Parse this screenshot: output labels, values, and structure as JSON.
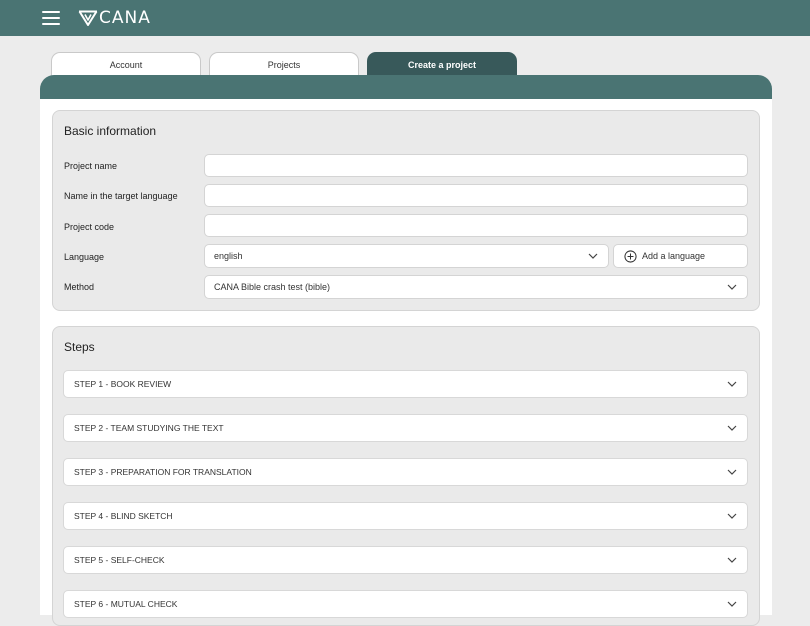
{
  "header": {
    "menu_icon": "hamburger-menu-icon",
    "logo_text": "CANA",
    "logo_icon": "v-triangle-logo-icon",
    "background": "#4a7473"
  },
  "tabs": [
    {
      "label": "Account",
      "active": false
    },
    {
      "label": "Projects",
      "active": false
    },
    {
      "label": "Create a project",
      "active": true
    }
  ],
  "basic_info": {
    "title": "Basic information",
    "fields": [
      {
        "label": "Project name",
        "value": "",
        "type": "text"
      },
      {
        "label": "Name in the target language",
        "value": "",
        "type": "text"
      },
      {
        "label": "Project code",
        "value": "",
        "type": "text"
      },
      {
        "label": "Language",
        "value": "english",
        "type": "select"
      },
      {
        "label": "Method",
        "value": "CANA Bible crash test (bible)",
        "type": "select"
      }
    ],
    "add_language_label": "Add a language",
    "add_language_icon": "plus-circle-icon"
  },
  "steps": {
    "title": "Steps",
    "items": [
      {
        "label": "STEP 1 - BOOK REVIEW"
      },
      {
        "label": "STEP 2 - TEAM STUDYING THE TEXT"
      },
      {
        "label": "STEP 3 - PREPARATION FOR TRANSLATION"
      },
      {
        "label": "STEP 4 - BLIND SKETCH"
      },
      {
        "label": "STEP 5 - SELF-CHECK"
      },
      {
        "label": "STEP 6 - MUTUAL CHECK"
      }
    ],
    "chevron_icon": "chevron-down-icon"
  },
  "colors": {
    "accent": "#4a7473",
    "accent_dark": "#38595a",
    "page_background": "#ececec"
  }
}
